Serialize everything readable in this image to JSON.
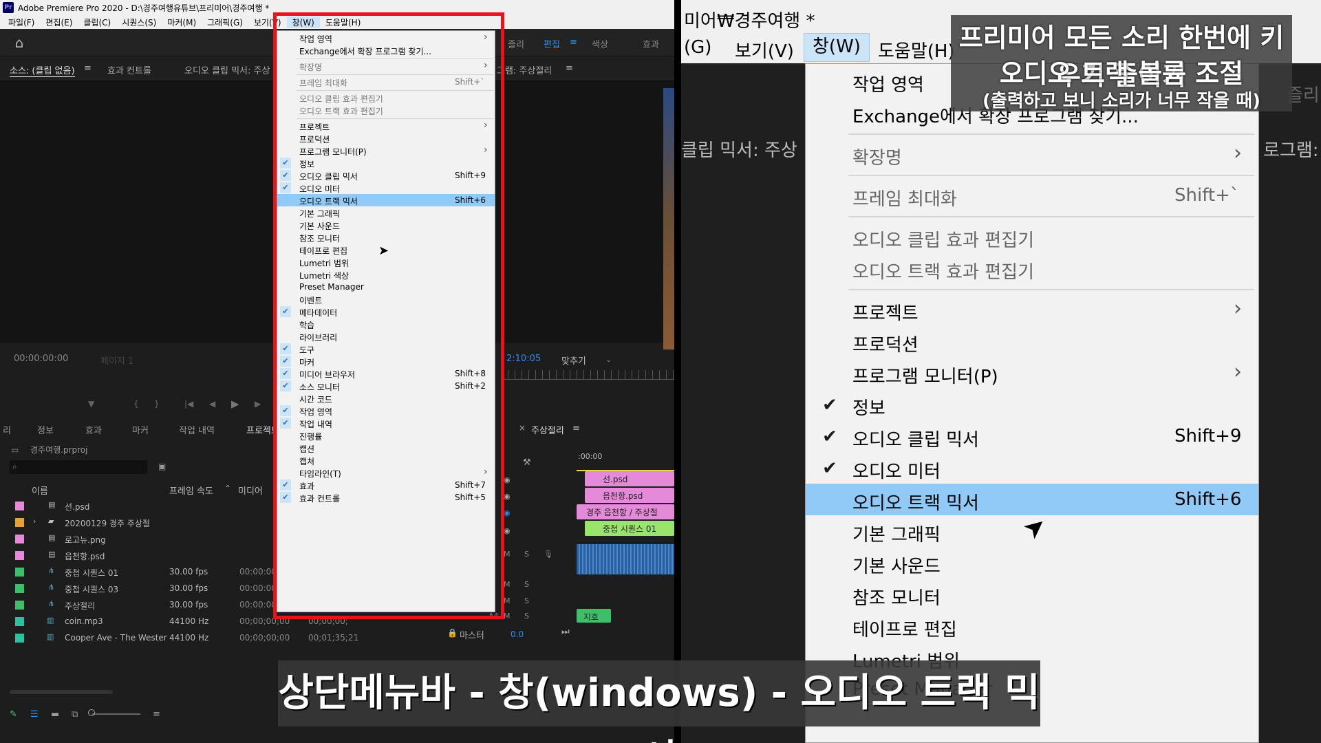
{
  "left": {
    "app_title": "Adobe Premiere Pro 2020 - D:\\경주여행유튜브\\프리미어\\경주여행 *",
    "logo": "Pr",
    "menubar": [
      "파일(F)",
      "편집(E)",
      "클립(C)",
      "시퀀스(S)",
      "마커(M)",
      "그래픽(G)",
      "보기(V)",
      "창(W)",
      "도움말(H)"
    ],
    "workspace_tabs": [
      "즐리",
      "편집",
      "색상",
      "효과"
    ],
    "panel_headers": [
      "소스: (클립 없음)",
      "효과 컨트롤",
      "오디오 클립 믹서: 주상",
      "그램: 주상절리"
    ],
    "source_timecode": "00:00:00:00",
    "source_page": "페이지 1",
    "program_timecode": "2:10:05",
    "program_fit": "맞추기",
    "bottom_tabs": [
      "리",
      "정보",
      "효과",
      "마커",
      "작업 내역",
      "프로젝트"
    ],
    "project_name": "경주여행.prproj",
    "col_name": "이름",
    "col_fps": "프레임 속도",
    "col_media": "미디어",
    "rows": [
      {
        "name": "선.psd",
        "fps": "",
        "tc1": "",
        "tc2": "",
        "color": "#e58ad8"
      },
      {
        "name": "20200129 경주 주상절",
        "fps": "",
        "tc1": "",
        "tc2": "",
        "color": "#e8a13a"
      },
      {
        "name": "로고뉴.png",
        "fps": "",
        "tc1": "",
        "tc2": "",
        "color": "#e58ad8"
      },
      {
        "name": "읍천항.psd",
        "fps": "",
        "tc1": "",
        "tc2": "",
        "color": "#e58ad8"
      },
      {
        "name": "중첩 시퀀스 01",
        "fps": "30.00 fps",
        "tc1": "00:00:00",
        "tc2": "",
        "color": "#3dbf6a"
      },
      {
        "name": "중첩 시퀀스 03",
        "fps": "30.00 fps",
        "tc1": "00:00:00",
        "tc2": "",
        "color": "#3dbf6a"
      },
      {
        "name": "주상절리",
        "fps": "30.00 fps",
        "tc1": "00:00:00",
        "tc2": "",
        "color": "#3dbf6a"
      },
      {
        "name": "coin.mp3",
        "fps": "44100 Hz",
        "tc1": "00;00;00;00",
        "tc2": "00;00;00;",
        "color": "#2ec0a0"
      },
      {
        "name": "Cooper Ave - The Wester",
        "fps": "44100 Hz",
        "tc1": "00;00;00;00",
        "tc2": "00;01;35;21",
        "color": "#2ec0a0"
      }
    ],
    "timeline_tab": "주상절리",
    "timeline_tc": ":00:00",
    "clips": [
      "선.psd",
      "읍천항.psd",
      "경주 읍천항 / 주상절",
      "중첩 시퀀스 01",
      "지호"
    ],
    "track_labels": [
      "A4"
    ],
    "master_label": "마스터",
    "master_value": "0.0"
  },
  "menu": {
    "items": [
      {
        "label": "작업 영역",
        "arrow": true
      },
      {
        "label": "Exchange에서 확장 프로그램 찾기..."
      },
      {
        "sep": true
      },
      {
        "label": "확장명",
        "arrow": true,
        "disabled": true
      },
      {
        "sep": true
      },
      {
        "label": "프레임 최대화",
        "shortcut": "Shift+`",
        "disabled": true
      },
      {
        "sep": true
      },
      {
        "label": "오디오 클립 효과 편집기",
        "disabled": true
      },
      {
        "label": "오디오 트랙 효과 편집기",
        "disabled": true
      },
      {
        "sep": true
      },
      {
        "label": "프로젝트",
        "arrow": true
      },
      {
        "label": "프로덕션"
      },
      {
        "label": "프로그램 모니터(P)",
        "arrow": true
      },
      {
        "label": "정보",
        "checked": true
      },
      {
        "label": "오디오 클립 믹서",
        "shortcut": "Shift+9",
        "checked": true
      },
      {
        "label": "오디오 미터",
        "checked": true
      },
      {
        "label": "오디오 트랙 믹서",
        "shortcut": "Shift+6",
        "highlighted": true
      },
      {
        "label": "기본 그래픽"
      },
      {
        "label": "기본 사운드"
      },
      {
        "label": "참조 모니터"
      },
      {
        "label": "테이프로 편집"
      },
      {
        "label": "Lumetri 범위"
      },
      {
        "label": "Lumetri 색상"
      },
      {
        "label": "Preset Manager"
      },
      {
        "label": "이벤트"
      },
      {
        "label": "메타데이터",
        "checked": true
      },
      {
        "label": "학습"
      },
      {
        "label": "라이브러리"
      },
      {
        "label": "도구",
        "checked": true
      },
      {
        "label": "마커",
        "checked": true
      },
      {
        "label": "미디어 브라우저",
        "shortcut": "Shift+8",
        "checked": true
      },
      {
        "label": "소스 모니터",
        "shortcut": "Shift+2",
        "checked": true
      },
      {
        "label": "시간 코드"
      },
      {
        "label": "작업 영역",
        "checked": true
      },
      {
        "label": "작업 내역",
        "checked": true
      },
      {
        "label": "진행률"
      },
      {
        "label": "캡션"
      },
      {
        "label": "캡처"
      },
      {
        "label": "타임라인(T)",
        "arrow": true
      },
      {
        "label": "효과",
        "shortcut": "Shift+7",
        "checked": true
      },
      {
        "label": "효과 컨트롤",
        "shortcut": "Shift+5",
        "checked": true
      }
    ]
  },
  "right": {
    "title_fragment": "미어₩경주여행 *",
    "menubar": [
      "(G)",
      "보기(V)",
      "창(W)",
      "도움말(H)"
    ],
    "side_texts": [
      "클립 믹서: 주상",
      "로그램:",
      "즐리"
    ],
    "items": [
      {
        "label": "작업 영역",
        "arrow": true
      },
      {
        "label": "Exchange에서 확장 프로그램 찾기..."
      },
      {
        "sep": true
      },
      {
        "label": "확장명",
        "arrow": true,
        "disabled": true
      },
      {
        "sep": true
      },
      {
        "label": "프레임 최대화",
        "shortcut": "Shift+`",
        "disabled": true
      },
      {
        "sep": true
      },
      {
        "label": "오디오 클립 효과 편집기",
        "disabled": true
      },
      {
        "label": "오디오 트랙 효과 편집기",
        "disabled": true
      },
      {
        "sep": true
      },
      {
        "label": "프로젝트",
        "arrow": true
      },
      {
        "label": "프로덕션"
      },
      {
        "label": "프로그램 모니터(P)",
        "arrow": true
      },
      {
        "label": "정보",
        "checked": true
      },
      {
        "label": "오디오 클립 믹서",
        "shortcut": "Shift+9",
        "checked": true
      },
      {
        "label": "오디오 미터",
        "checked": true
      },
      {
        "label": "오디오 트랙 믹서",
        "shortcut": "Shift+6",
        "highlighted": true
      },
      {
        "label": "기본 그래픽"
      },
      {
        "label": "기본 사운드"
      },
      {
        "label": "참조 모니터"
      },
      {
        "label": "테이프로 편집"
      },
      {
        "label": "Lumetri 범위"
      },
      {
        "label": "Preset Manager"
      }
    ]
  },
  "caption": {
    "line1": "프리미어 모든 소리 한번에 키우기 줄이기",
    "line2": "오디오 트랙 볼륨 조절",
    "line3": "(출력하고 보니 소리가 너무 작을 때)"
  },
  "bottom_caption": "상단메뉴바 - 창(windows) - 오디오 트랙 믹서",
  "icons": {
    "check": "✔",
    "arrow": "›",
    "home": "⌂",
    "cursor": "mouse-pointer-icon"
  }
}
